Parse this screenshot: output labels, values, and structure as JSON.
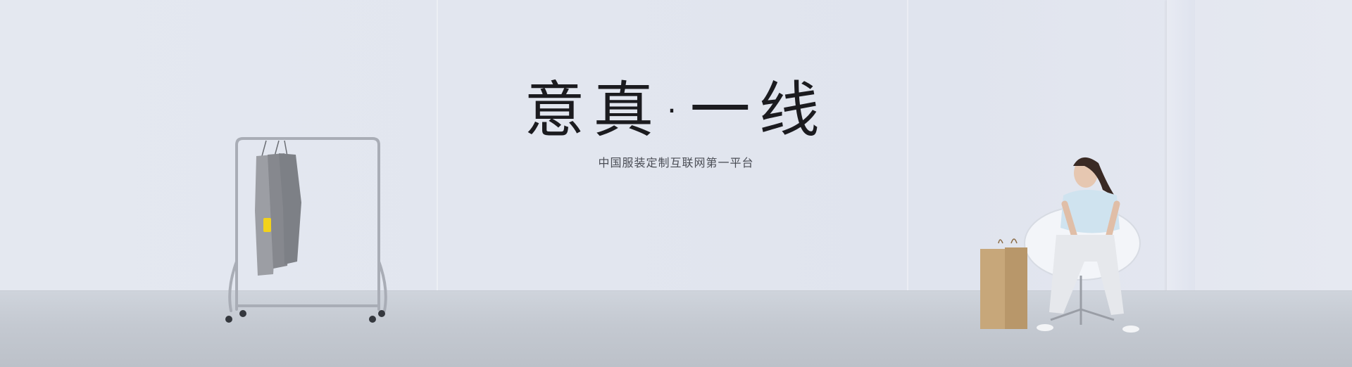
{
  "banner": {
    "title": "意真·一线",
    "subtitle": "中国服装定制互联网第一平台"
  },
  "colors": {
    "wall": "#e3e7ef",
    "floor": "#c4c9d1",
    "title_text": "#1b1b1f",
    "subtitle_text": "#4a4d55",
    "bag": "#c7a77a",
    "shirt": "#8d8f95",
    "top": "#cfe3ef",
    "tag": "#f2d21b"
  },
  "icons": [
    "clothing-rack-icon",
    "price-tag-icon",
    "shopping-bag-icon",
    "chair-icon"
  ]
}
